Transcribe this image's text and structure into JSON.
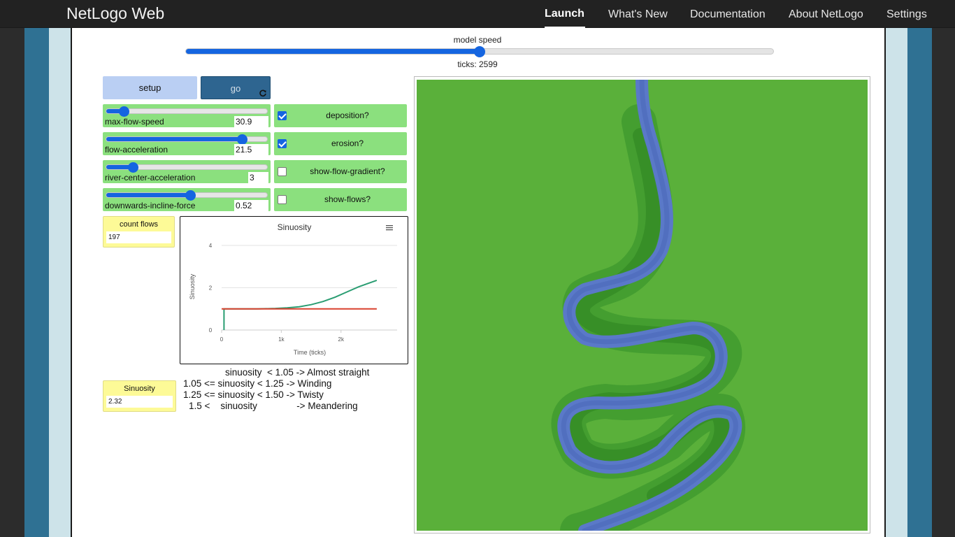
{
  "navbar": {
    "brand": "NetLogo Web",
    "items": [
      {
        "label": "Launch",
        "active": true
      },
      {
        "label": "What's New"
      },
      {
        "label": "Documentation"
      },
      {
        "label": "About NetLogo"
      },
      {
        "label": "Settings"
      }
    ]
  },
  "speed": {
    "label": "model speed",
    "value": 0.5
  },
  "ticks": {
    "label": "ticks: 2599"
  },
  "buttons": {
    "setup": "setup",
    "go": "go",
    "go_icon": "forever-icon"
  },
  "sliders": [
    {
      "name": "max-flow-speed",
      "value": "30.9",
      "fraction": 0.11
    },
    {
      "name": "flow-acceleration",
      "value": "21.5",
      "fraction": 0.84
    },
    {
      "name": "river-center-acceleration",
      "value": "3",
      "fraction": 0.17
    },
    {
      "name": "downwards-incline-force",
      "value": "0.52",
      "fraction": 0.52
    }
  ],
  "switches": [
    {
      "name": "deposition?",
      "on": true
    },
    {
      "name": "erosion?",
      "on": true
    },
    {
      "name": "show-flow-gradient?",
      "on": false
    },
    {
      "name": "show-flows?",
      "on": false
    }
  ],
  "monitors": {
    "count_flows": {
      "label": "count flows",
      "value": "197"
    },
    "sinuosity": {
      "label": "Sinuosity",
      "value": "2.32"
    }
  },
  "notes": {
    "line1": "sinuosity  < 1.05 -> Almost straight",
    "line2": "1.05 <= sinuosity < 1.25 -> Winding",
    "line3": "1.25 <= sinuosity < 1.50 -> Twisty",
    "line4": "1.5 <    sinuosity               -> Meandering"
  },
  "colors": {
    "accent": "#1565e0",
    "widget_green": "#8be07e",
    "monitor_yellow": "#fdfa97",
    "patch_green": "#5ab03a",
    "river_blue": "#5a79c8"
  },
  "chart_data": {
    "type": "line",
    "title": "Sinuosity",
    "xlabel": "Time (ticks)",
    "ylabel": "Sinuosity",
    "xlim": [
      0,
      2940
    ],
    "ylim": [
      0,
      4
    ],
    "x_ticks": [
      {
        "value": 0,
        "label": "0"
      },
      {
        "value": 1000,
        "label": "1k"
      },
      {
        "value": 2000,
        "label": "2k"
      }
    ],
    "y_ticks": [
      {
        "value": 0,
        "label": "0"
      },
      {
        "value": 2,
        "label": "2"
      },
      {
        "value": 4,
        "label": "4"
      }
    ],
    "menu_icon": "hamburger-icon",
    "series": [
      {
        "color": "#2a9d72",
        "x": [
          40,
          40,
          300,
          600,
          900,
          1100,
          1300,
          1500,
          1700,
          1900,
          2100,
          2300,
          2450,
          2599
        ],
        "y": [
          0,
          1.0,
          1.0,
          1.0,
          1.02,
          1.05,
          1.1,
          1.2,
          1.35,
          1.55,
          1.8,
          2.05,
          2.2,
          2.35
        ]
      },
      {
        "color": "#d9412f",
        "x": [
          0,
          2599
        ],
        "y": [
          1.0,
          1.0
        ]
      }
    ]
  }
}
